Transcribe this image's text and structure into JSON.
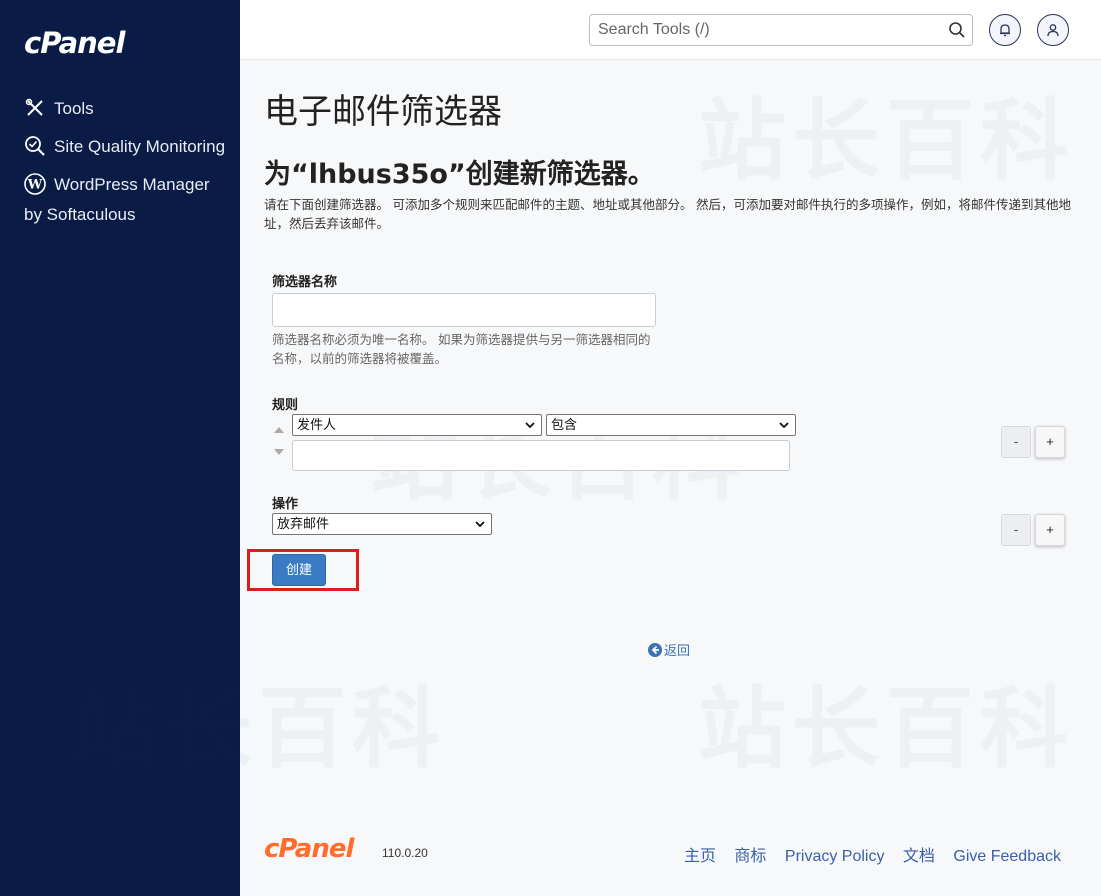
{
  "sidebar": {
    "brand": "cPanel",
    "items": [
      {
        "label": "Tools",
        "icon": "tools-icon"
      },
      {
        "label": "Site Quality Monitoring",
        "icon": "site-quality-icon"
      },
      {
        "label": "WordPress Manager by Softaculous",
        "icon": "wordpress-icon"
      }
    ]
  },
  "header": {
    "search_placeholder": "Search Tools (/)"
  },
  "main": {
    "page_title": "电子邮件筛选器",
    "sub_title": "为“lhbus35o”创建新筛选器。",
    "description": "请在下面创建筛选器。 可添加多个规则来匹配邮件的主题、地址或其他部分。 然后，可添加要对邮件执行的多项操作，例如，将邮件传递到其他地址，然后丢弃该邮件。",
    "filter_name_label": "筛选器名称",
    "filter_name_value": "",
    "filter_name_help": "筛选器名称必须为唯一名称。 如果为筛选器提供与另一筛选器相同的名称，以前的筛选器将被覆盖。",
    "rules_label": "规则",
    "rule_field": "发件人",
    "rule_operator": "包含",
    "rule_value": "",
    "actions_label": "操作",
    "action_value": "放弃邮件",
    "minus_label": "-",
    "plus_label": "+",
    "create_button": "创建",
    "back_link": "返回"
  },
  "footer": {
    "logo": "cPanel",
    "version": "110.0.20",
    "links": [
      "主页",
      "商标",
      "Privacy Policy",
      "文档",
      "Give Feedback"
    ]
  },
  "colors": {
    "sidebar_bg": "#0a1c45",
    "primary_button": "#3a7cc4",
    "highlight_border": "#e01b1b",
    "footer_logo": "#ff6c2c"
  }
}
